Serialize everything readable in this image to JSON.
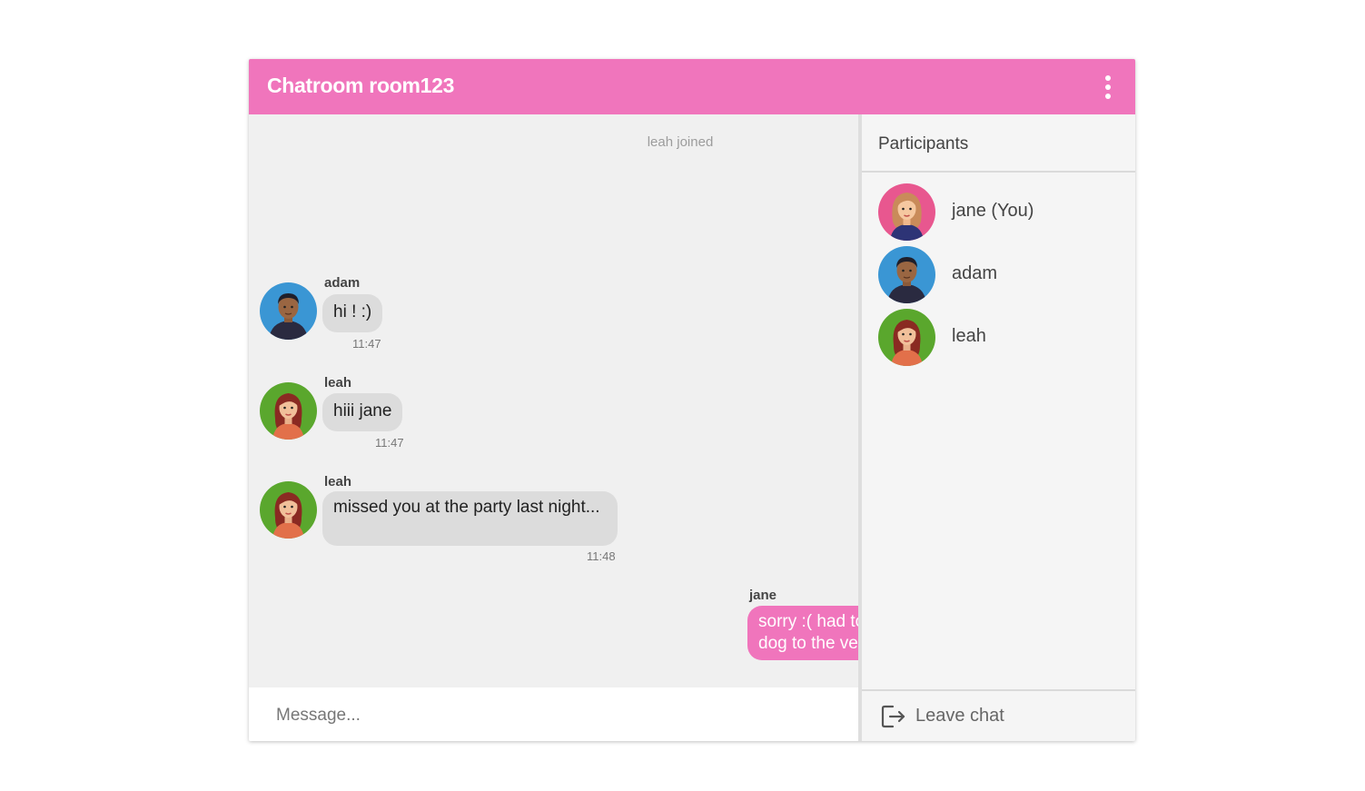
{
  "header": {
    "title": "Chatroom room123",
    "menu_icon": "more-vertical-icon"
  },
  "chat": {
    "system_message": "leah joined",
    "messages": [
      {
        "sender": "adam",
        "text": "hi ! :)",
        "time": "11:47"
      },
      {
        "sender": "leah",
        "text": "hiii jane",
        "time": "11:47"
      },
      {
        "sender": "leah",
        "text": "missed you at the party last night...",
        "time": "11:48"
      },
      {
        "sender": "jane",
        "text": "sorry :( had to take my dog to the vet",
        "time": ""
      }
    ]
  },
  "composer": {
    "placeholder": "Message..."
  },
  "sidebar": {
    "title": "Participants",
    "participants": [
      {
        "name": "jane (You)"
      },
      {
        "name": "adam"
      },
      {
        "name": "leah"
      }
    ],
    "leave_label": "Leave chat",
    "leave_icon": "logout-icon"
  },
  "colors": {
    "accent": "#f075bc",
    "avatar_pink": "#e8578f",
    "avatar_blue": "#3a96d4",
    "avatar_green": "#5aa72d"
  }
}
